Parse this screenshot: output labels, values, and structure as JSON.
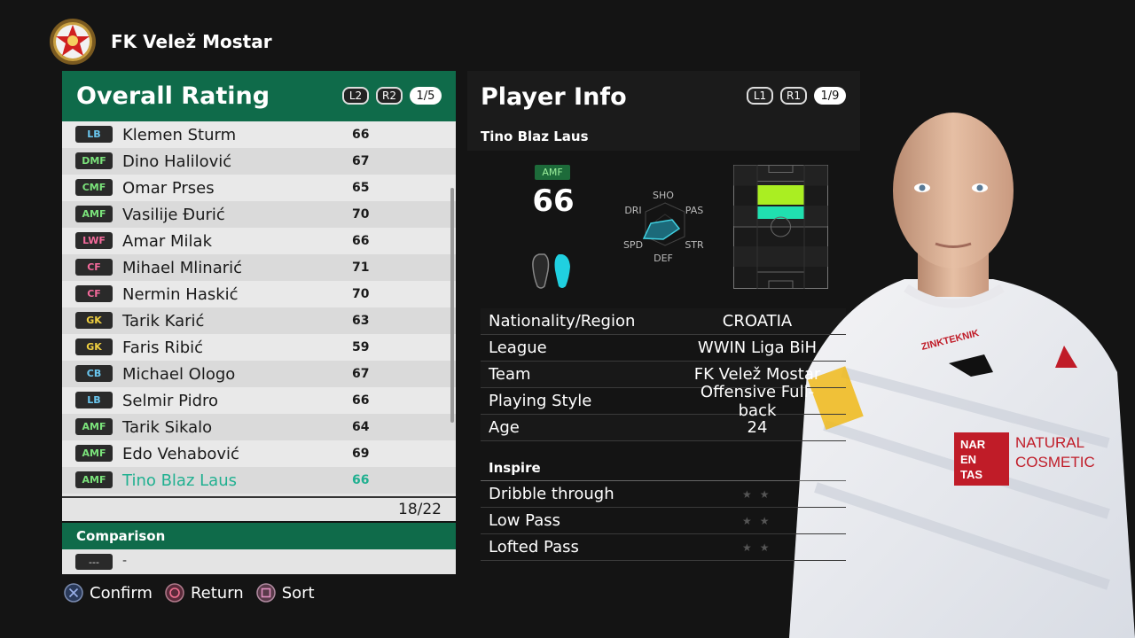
{
  "club": {
    "name": "FK Velež Mostar"
  },
  "overall": {
    "title": "Overall Rating",
    "badges": [
      "L2",
      "R2"
    ],
    "page": "1/5",
    "players": [
      {
        "pos": "LB",
        "pos_color": "#6ac7f0",
        "name": "Klemen Sturm",
        "rating": "66"
      },
      {
        "pos": "DMF",
        "pos_color": "#7be37b",
        "name": "Dino Halilović",
        "rating": "67"
      },
      {
        "pos": "CMF",
        "pos_color": "#7be37b",
        "name": "Omar Prses",
        "rating": "65"
      },
      {
        "pos": "AMF",
        "pos_color": "#7be37b",
        "name": "Vasilije Đurić",
        "rating": "70"
      },
      {
        "pos": "LWF",
        "pos_color": "#f46a9b",
        "name": "Amar Milak",
        "rating": "66"
      },
      {
        "pos": "CF",
        "pos_color": "#f46a9b",
        "name": "Mihael Mlinarić",
        "rating": "71"
      },
      {
        "pos": "CF",
        "pos_color": "#f46a9b",
        "name": "Nermin Haskić",
        "rating": "70"
      },
      {
        "pos": "GK",
        "pos_color": "#f0d040",
        "name": "Tarik Karić",
        "rating": "63"
      },
      {
        "pos": "GK",
        "pos_color": "#f0d040",
        "name": "Faris Ribić",
        "rating": "59"
      },
      {
        "pos": "CB",
        "pos_color": "#6ac7f0",
        "name": "Michael Ologo",
        "rating": "67"
      },
      {
        "pos": "LB",
        "pos_color": "#6ac7f0",
        "name": "Selmir Pidro",
        "rating": "66"
      },
      {
        "pos": "AMF",
        "pos_color": "#7be37b",
        "name": "Tarik Sikalo",
        "rating": "64"
      },
      {
        "pos": "AMF",
        "pos_color": "#7be37b",
        "name": "Edo Vehabović",
        "rating": "69"
      },
      {
        "pos": "AMF",
        "pos_color": "#7be37b",
        "name": "Tino Blaz Laus",
        "rating": "66",
        "selected": true
      }
    ],
    "count": "18/22"
  },
  "comparison": {
    "title": "Comparison",
    "pos": "---",
    "name": "-"
  },
  "controls": [
    {
      "icon": "cross-icon",
      "label": "Confirm"
    },
    {
      "icon": "circle-icon",
      "label": "Return"
    },
    {
      "icon": "square-icon",
      "label": "Sort"
    }
  ],
  "player_info": {
    "title": "Player Info",
    "badges": [
      "L1",
      "R1"
    ],
    "page": "1/9",
    "name": "Tino Blaz Laus",
    "position": "AMF",
    "rating": "66",
    "radar_labels": [
      "SHO",
      "PAS",
      "STR",
      "DEF",
      "SPD",
      "DRI"
    ],
    "details": [
      {
        "label": "Nationality/Region",
        "value": "CROATIA"
      },
      {
        "label": "League",
        "value": "WWIN Liga BiH"
      },
      {
        "label": "Team",
        "value": "FK Velež Mostar"
      },
      {
        "label": "Playing Style",
        "value": "Offensive Full-back"
      },
      {
        "label": "Age",
        "value": "24"
      }
    ],
    "inspire_title": "Inspire",
    "inspire": [
      {
        "label": "Dribble through"
      },
      {
        "label": "Low Pass"
      },
      {
        "label": "Lofted Pass"
      }
    ]
  },
  "colors": {
    "accent_green": "#0f6b4a",
    "selected_text": "#20b090",
    "highlight_zone": "#aaee22",
    "secondary_zone": "#20e0b0"
  }
}
